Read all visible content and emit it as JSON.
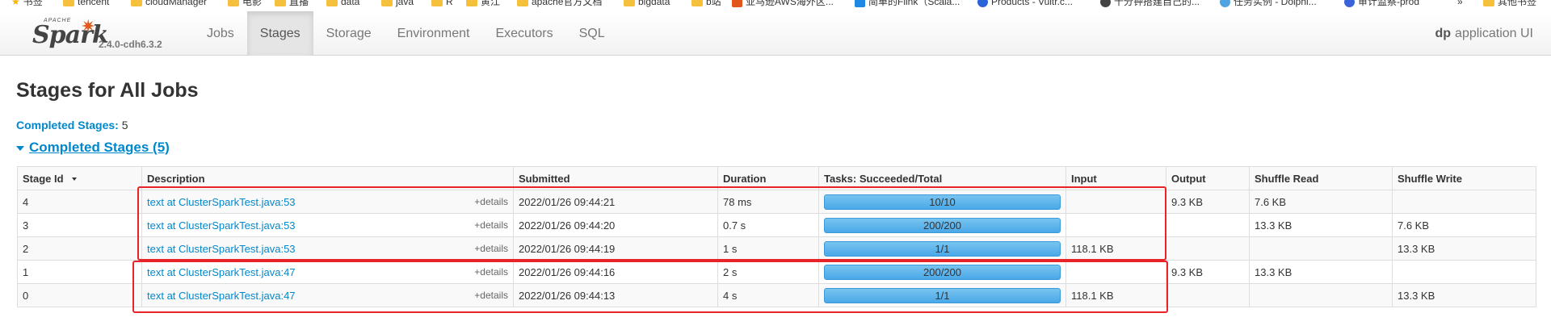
{
  "bookmarks": [
    {
      "label": "书签",
      "icon": "star-icon"
    },
    {
      "label": "tencent",
      "icon": "folder-icon"
    },
    {
      "label": "cloudManager",
      "icon": "folder-icon"
    },
    {
      "label": "电影",
      "icon": "folder-icon"
    },
    {
      "label": "直播",
      "icon": "folder-icon"
    },
    {
      "label": "data",
      "icon": "folder-icon"
    },
    {
      "label": "java",
      "icon": "folder-icon"
    },
    {
      "label": "R",
      "icon": "folder-icon"
    },
    {
      "label": "黄江",
      "icon": "folder-icon"
    },
    {
      "label": "apache官方文档",
      "icon": "folder-icon"
    },
    {
      "label": "bigdata",
      "icon": "folder-icon"
    },
    {
      "label": "b站",
      "icon": "folder-icon"
    },
    {
      "label": "亚马逊AWS海外区...",
      "icon": "aws-icon"
    },
    {
      "label": "简单的Flink（Scala...",
      "icon": "page-icon"
    },
    {
      "label": "Products - Vultr.c...",
      "icon": "vultr-icon"
    },
    {
      "label": "十分钟搭建自己的...",
      "icon": "github-icon"
    },
    {
      "label": "任务实例 - Dolphi...",
      "icon": "dolphin-icon"
    },
    {
      "label": "审计监察-prod",
      "icon": "audit-icon"
    },
    {
      "label": "»",
      "icon": ""
    },
    {
      "label": "其他书签",
      "icon": "folder-icon"
    }
  ],
  "navbar": {
    "brand_apache": "APACHE",
    "brand_name": "Spark",
    "version": "2.4.0-cdh6.3.2",
    "tabs": [
      "Jobs",
      "Stages",
      "Storage",
      "Environment",
      "Executors",
      "SQL"
    ],
    "active_tab": "Stages",
    "app_name_bold": "dp",
    "app_name_rest": "application UI"
  },
  "page": {
    "title": "Stages for All Jobs",
    "summary_label": "Completed Stages:",
    "summary_value": "5",
    "section_title": "Completed Stages (5)"
  },
  "table": {
    "headers": [
      "Stage Id",
      "Description",
      "Submitted",
      "Duration",
      "Tasks: Succeeded/Total",
      "Input",
      "Output",
      "Shuffle Read",
      "Shuffle Write"
    ],
    "details_label": "+details",
    "rows": [
      {
        "id": "4",
        "desc": "text at ClusterSparkTest.java:53",
        "submitted": "2022/01/26 09:44:21",
        "duration": "78 ms",
        "tasks": "10/10",
        "progress": 1.0,
        "input": "",
        "output": "9.3 KB",
        "shuffle_read": "7.6 KB",
        "shuffle_write": ""
      },
      {
        "id": "3",
        "desc": "text at ClusterSparkTest.java:53",
        "submitted": "2022/01/26 09:44:20",
        "duration": "0.7 s",
        "tasks": "200/200",
        "progress": 1.0,
        "input": "",
        "output": "",
        "shuffle_read": "13.3 KB",
        "shuffle_write": "7.6 KB"
      },
      {
        "id": "2",
        "desc": "text at ClusterSparkTest.java:53",
        "submitted": "2022/01/26 09:44:19",
        "duration": "1 s",
        "tasks": "1/1",
        "progress": 1.0,
        "input": "118.1 KB",
        "output": "",
        "shuffle_read": "",
        "shuffle_write": "13.3 KB"
      },
      {
        "id": "1",
        "desc": "text at ClusterSparkTest.java:47",
        "submitted": "2022/01/26 09:44:16",
        "duration": "2 s",
        "tasks": "200/200",
        "progress": 1.0,
        "input": "",
        "output": "9.3 KB",
        "shuffle_read": "13.3 KB",
        "shuffle_write": ""
      },
      {
        "id": "0",
        "desc": "text at ClusterSparkTest.java:47",
        "submitted": "2022/01/26 09:44:13",
        "duration": "4 s",
        "tasks": "1/1",
        "progress": 1.0,
        "input": "118.1 KB",
        "output": "",
        "shuffle_read": "",
        "shuffle_write": "13.3 KB"
      }
    ]
  },
  "colors": {
    "link": "#0088cc",
    "highlight": "#e8232a",
    "progress": "#4aa8e8",
    "spark_orange": "#e25a1c"
  }
}
